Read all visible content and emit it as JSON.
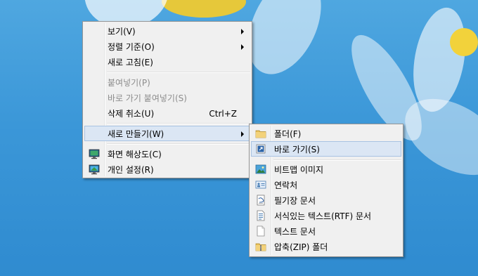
{
  "context_menu": {
    "items": [
      {
        "label": "보기(V)",
        "has_submenu": true
      },
      {
        "label": "정렬 기준(O)",
        "has_submenu": true
      },
      {
        "label": "새로 고침(E)"
      },
      {
        "label": "붙여넣기(P)",
        "disabled": true
      },
      {
        "label": "바로 가기 붙여넣기(S)",
        "disabled": true
      },
      {
        "label": "삭제 취소(U)",
        "shortcut": "Ctrl+Z"
      },
      {
        "label": "새로 만들기(W)",
        "has_submenu": true,
        "highlighted": true
      },
      {
        "label": "화면 해상도(C)",
        "icon": "monitor-icon"
      },
      {
        "label": "개인 설정(R)",
        "icon": "personalize-icon"
      }
    ]
  },
  "new_submenu": {
    "items": [
      {
        "label": "폴더(F)",
        "icon": "folder-icon"
      },
      {
        "label": "바로 가기(S)",
        "icon": "shortcut-icon",
        "highlighted": true
      },
      {
        "label": "비트맵 이미지",
        "icon": "bitmap-icon"
      },
      {
        "label": "연락처",
        "icon": "contact-icon"
      },
      {
        "label": "필기장 문서",
        "icon": "journal-icon"
      },
      {
        "label": "서식있는 텍스트(RTF) 문서",
        "icon": "rtf-document-icon"
      },
      {
        "label": "텍스트 문서",
        "icon": "text-document-icon"
      },
      {
        "label": "압축(ZIP) 폴더",
        "icon": "zip-folder-icon"
      }
    ]
  },
  "colors": {
    "highlight": "#dbe6f4",
    "highlight_border": "#a9c3e3",
    "menu_bg": "#f0f0f0",
    "disabled_text": "#8c8c8c"
  }
}
